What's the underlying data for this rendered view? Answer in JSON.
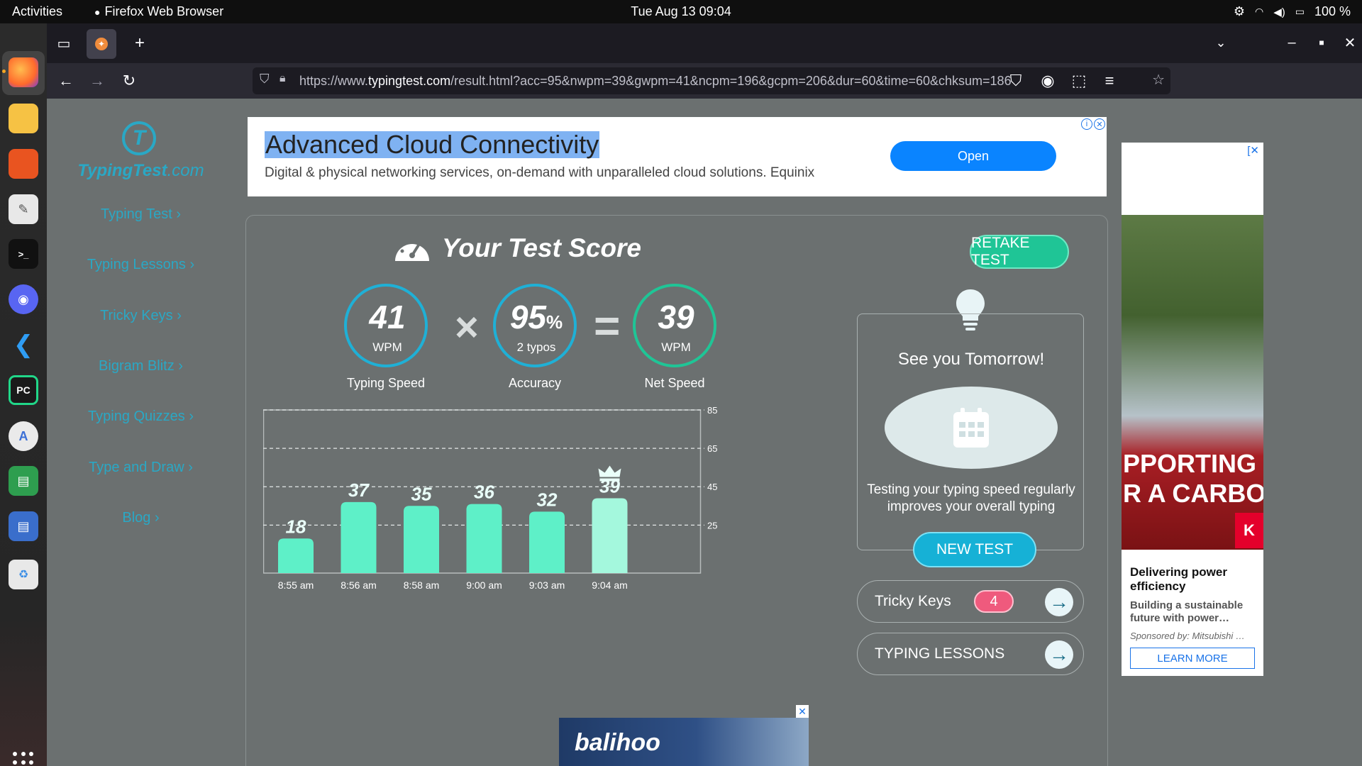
{
  "system": {
    "activities": "Activities",
    "app_name": "Firefox Web Browser",
    "clock": "Tue Aug 13  09:04",
    "battery": "100 %"
  },
  "browser": {
    "url_prefix": "https://www.",
    "url_host": "typingtest.com",
    "url_rest": "/result.html?acc=95&nwpm=39&gwpm=41&ncpm=196&gcpm=206&dur=60&time=60&chksum=186"
  },
  "sidebar": {
    "logo_mark": "T",
    "logo_main": "TypingTest",
    "logo_suffix": ".com",
    "links": [
      "Typing Test",
      "Typing Lessons",
      "Tricky Keys",
      "Bigram Blitz",
      "Typing Quizzes",
      "Type and Draw",
      "Blog"
    ]
  },
  "ad_top": {
    "headline": "Advanced Cloud Connectivity",
    "description": "Digital & physical networking services, on-demand with unparalleled cloud solutions. Equinix",
    "button": "Open"
  },
  "results": {
    "title": "Your Test Score",
    "retake": "RETAKE TEST",
    "typing_speed": {
      "value": "41",
      "unit": "WPM",
      "caption": "Typing Speed"
    },
    "accuracy": {
      "value": "95",
      "unit": "%",
      "sub": "2 typos",
      "caption": "Accuracy"
    },
    "net_speed": {
      "value": "39",
      "unit": "WPM",
      "caption": "Net Speed"
    },
    "times_op": "×",
    "equals_op": "="
  },
  "chart_data": {
    "type": "bar",
    "categories": [
      "8:55 am",
      "8:56 am",
      "8:58 am",
      "9:00 am",
      "9:03 am",
      "9:04 am"
    ],
    "values": [
      18,
      37,
      35,
      36,
      32,
      39
    ],
    "highlight_index": 5,
    "y_ticks": [
      25,
      45,
      65,
      85
    ],
    "ylim": [
      0,
      85
    ],
    "colors": {
      "bar": "#5ef0c8",
      "highlight": "#a4f8dd"
    }
  },
  "tomorrow": {
    "title": "See you Tomorrow!",
    "description": "Testing your typing speed regularly improves your overall typing",
    "button": "NEW TEST"
  },
  "tricky_keys": {
    "label": "Tricky Keys",
    "count": "4"
  },
  "typing_lessons": {
    "label": "TYPING LESSONS"
  },
  "ad_bottom": {
    "logo": "balihoo"
  },
  "ad_right": {
    "overlay_line1": "PPORTING",
    "overlay_line2": "R A CARBON",
    "brand_mark": "K",
    "title": "Delivering power efficiency",
    "text": "Building a sustainable future with power…",
    "sponsor": "Sponsored by: Mitsubishi …",
    "button": "LEARN MORE"
  }
}
